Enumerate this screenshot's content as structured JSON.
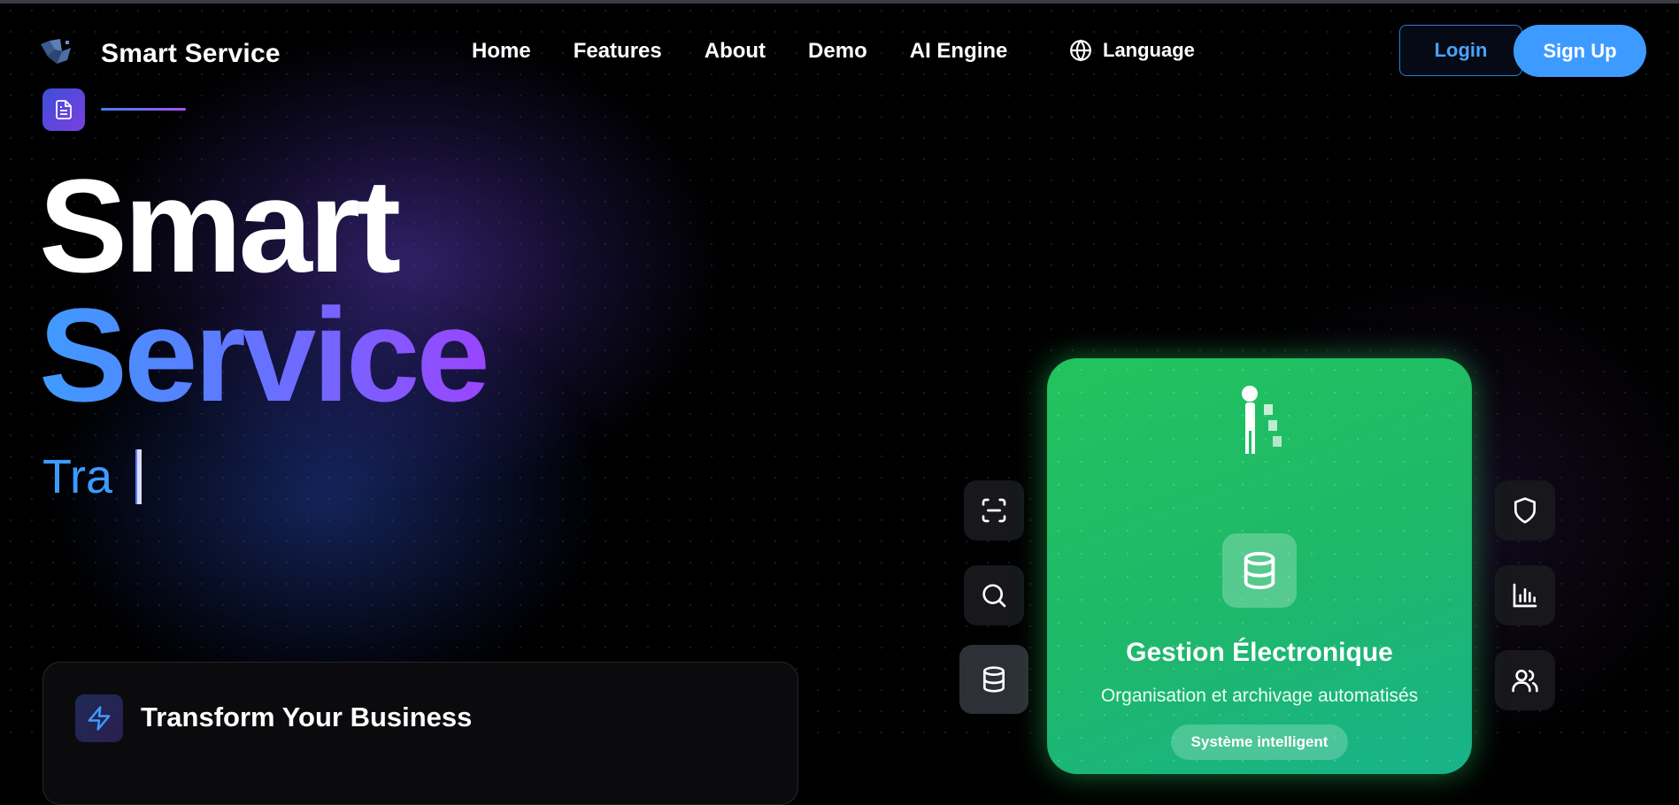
{
  "nav": {
    "brand": "Smart Service",
    "links": [
      "Home",
      "Features",
      "About",
      "Demo",
      "AI Engine"
    ],
    "language": "Language",
    "login": "Login",
    "signup": "Sign Up"
  },
  "hero": {
    "line1": "Smart",
    "line2": "Service",
    "typing": "Tra"
  },
  "transform_card": {
    "title": "Transform Your Business",
    "icon": "lightning-icon"
  },
  "left_tiles": [
    "scan-icon",
    "search-icon",
    "database-icon"
  ],
  "right_tiles": [
    "shield-icon",
    "bar-chart-icon",
    "users-icon"
  ],
  "feature_card": {
    "title": "Gestion Électronique",
    "subtitle": "Organisation et archivage automatisés",
    "badge": "Système intelligent",
    "icon": "database-icon"
  },
  "colors": {
    "accent_blue": "#3d9bff",
    "accent_purple": "#9a45ff",
    "card_green": "#22c35e"
  }
}
